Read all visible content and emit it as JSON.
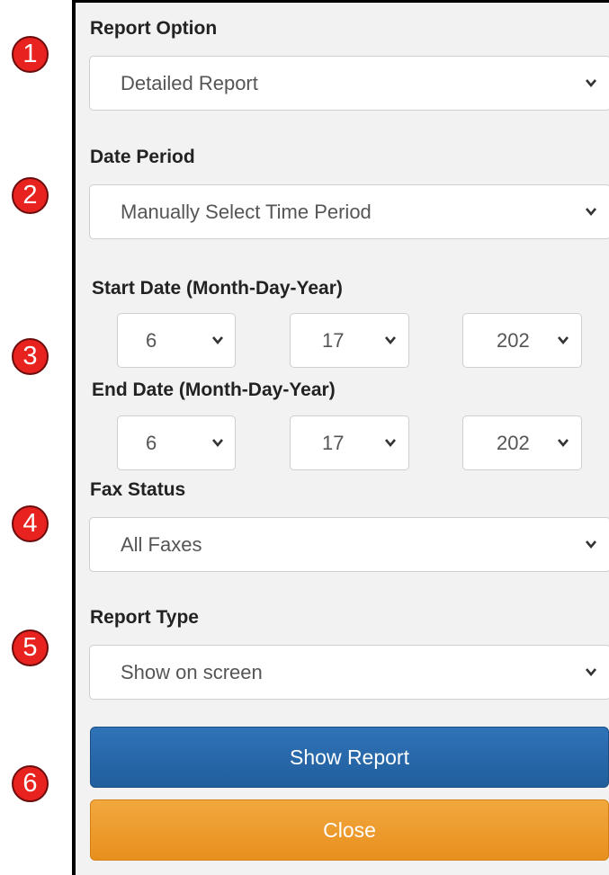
{
  "markers": [
    "1",
    "2",
    "3",
    "4",
    "5",
    "6"
  ],
  "report_option": {
    "label": "Report Option",
    "value": "Detailed Report"
  },
  "date_period": {
    "label": "Date Period",
    "value": "Manually Select Time Period"
  },
  "start_date": {
    "label": "Start Date (Month-Day-Year)",
    "month": "6",
    "day": "17",
    "year": "202"
  },
  "end_date": {
    "label": "End Date (Month-Day-Year)",
    "month": "6",
    "day": "17",
    "year": "202"
  },
  "fax_status": {
    "label": "Fax Status",
    "value": "All Faxes"
  },
  "report_type": {
    "label": "Report Type",
    "value": "Show on screen"
  },
  "buttons": {
    "show_report": "Show Report",
    "close": "Close"
  },
  "colors": {
    "marker": "#e8221f",
    "primary": "#2a6aad",
    "warning": "#ed9c2f",
    "panel_bg": "#f2f2f2"
  },
  "icons": {
    "dropdown": "chevron-down-icon"
  }
}
